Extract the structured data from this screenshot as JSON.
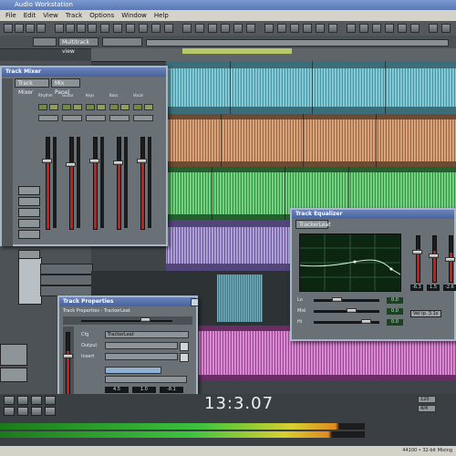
{
  "window": {
    "title": "Audio Workstation",
    "menu": [
      "File",
      "Edit",
      "View",
      "Track",
      "Options",
      "Window",
      "Help"
    ]
  },
  "tabs": [
    "",
    "Multitrack view",
    ""
  ],
  "track_properties": {
    "title": "Track Properties",
    "track_name_label": "Track Properties - TrackerLeat",
    "cfg_label": "Cfg",
    "cfg_value": "TrackerLeat",
    "output_label": "Output",
    "insert_label": "Insert",
    "values": [
      "4.5",
      "1.0",
      "-8.1"
    ]
  },
  "eq_panel": {
    "title": "Track Equalizer",
    "tab": "TrackerLeat",
    "readouts": [
      "-6.3",
      "1.5",
      "-2.6"
    ],
    "band_labels": [
      "Lo",
      "Mid",
      "Hi"
    ],
    "band_values": [
      "0.0",
      "0.0",
      "0.0"
    ],
    "button": "Vel ip. 3.1s"
  },
  "mixer_panel": {
    "title": "Track Mixer",
    "tabs": [
      "Track Mixer",
      "Mix Panel"
    ],
    "channels": [
      "Rhythm",
      "Guitar",
      "Keys",
      "Bass",
      "Vocal"
    ]
  },
  "transport": {
    "timecode": "13:3.07",
    "tempo": "120",
    "position": "4/4"
  },
  "status": {
    "text": "44100 • 32-bit Mixing"
  },
  "colors": {
    "track1": "#5fb7c8",
    "track2": "#c98a5a",
    "track3": "#3fae4f",
    "track4": "#9d86c8",
    "track5": "#c75ab7",
    "panel_border": "#a9b6c6",
    "title_blue": "#4662a0"
  }
}
